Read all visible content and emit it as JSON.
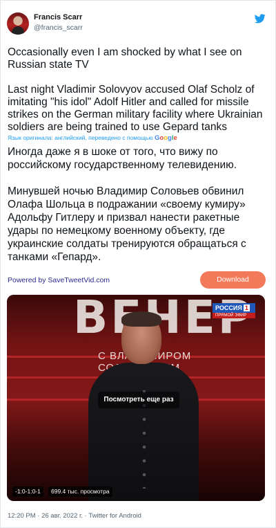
{
  "author": {
    "name": "Francis Scarr",
    "handle": "@francis_scarr",
    "icons": {
      "avatar": "profile-photo",
      "logo": "twitter-bird-icon"
    }
  },
  "tweet": {
    "text_en_p1": "Occasionally even I am shocked by what I see on Russian state TV",
    "text_en_p2": "Last night Vladimir Solovyov accused Olaf Scholz of imitating \"his idol\" Adolf Hitler and called for missile strikes on the German military facility where Ukrainian soldiers are being trained to use Gepard tanks",
    "translation_note": "Язык оригинала: английский, переведено с помощью",
    "translation_brand": [
      "G",
      "o",
      "o",
      "g",
      "l",
      "e"
    ],
    "text_ru_p1": "Иногда даже я в шоке от того, что вижу по российскому государственному телевидению.",
    "text_ru_p2": "Минувшей ночью Владимир Соловьев обвинил Олафа Шольца в подражании «своему кумиру» Адольфу Гитлеру и призвал нанести ракетные удары по немецкому военному объекту, где украинские солдаты тренируются обращаться с танками «Гепард»."
  },
  "widget": {
    "powered_by": "Powered by SaveTweetVid.com",
    "download_label": "Download"
  },
  "video": {
    "show_title": "ВЕЧЕР",
    "show_subtitle": "С ВЛАДИМИРОМ СОЛОВЬЕВЫМ",
    "channel": "РОССИЯ",
    "channel_number": "1",
    "channel_sub": "ПРЯМОЙ ЭФИР",
    "replay_label": "Посмотреть еще раз",
    "time_badge": "-1:0-1:0-1",
    "views": "699.4 тыс. просмотра"
  },
  "footer": {
    "meta": "12:20 PM · 26 авг. 2022 г. · Twitter for Android"
  },
  "colors": {
    "twitter_blue": "#1d9bf0",
    "download_bg": "#f27a5a",
    "powered_link": "#2d2a8c"
  }
}
